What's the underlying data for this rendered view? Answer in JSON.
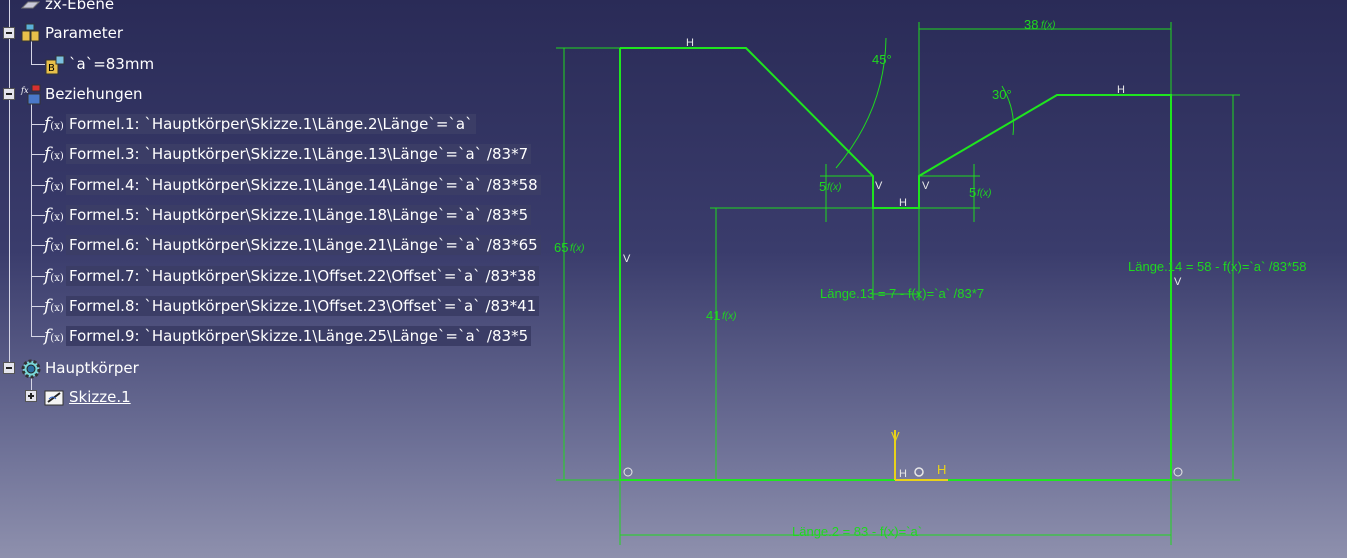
{
  "tree": {
    "top_item": "zx-Ebene",
    "parameter_label": "Parameter",
    "parameter_value": "`a`=83mm",
    "relations_label": "Beziehungen",
    "formulas": [
      "Formel.1: `Hauptkörper\\Skizze.1\\Länge.2\\Länge`=`a`",
      "Formel.3: `Hauptkörper\\Skizze.1\\Länge.13\\Länge`=`a` /83*7",
      "Formel.4: `Hauptkörper\\Skizze.1\\Länge.14\\Länge`=`a` /83*58",
      "Formel.5: `Hauptkörper\\Skizze.1\\Länge.18\\Länge`=`a` /83*5",
      "Formel.6: `Hauptkörper\\Skizze.1\\Länge.21\\Länge`=`a` /83*65",
      "Formel.7: `Hauptkörper\\Skizze.1\\Offset.22\\Offset`=`a` /83*38",
      "Formel.8: `Hauptkörper\\Skizze.1\\Offset.23\\Offset`=`a` /83*41",
      "Formel.9: `Hauptkörper\\Skizze.1\\Länge.25\\Länge`=`a` /83*5"
    ],
    "body_label": "Hauptkörper",
    "sketch_label": "Skizze.1"
  },
  "sketch": {
    "dims": {
      "d38": "38",
      "d45deg": "45°",
      "d30deg": "30°",
      "d5_left": "5",
      "d5_right": "5",
      "d65": "65",
      "d41": "41",
      "len13": "Länge.13 = 7 - f(x)=`a` /83*7",
      "len14": "Länge.14 = 58 - f(x)=`a` /83*58",
      "len2": "Länge.2 = 83 - f(x)=`a`"
    },
    "fx_glyph": "f(x)",
    "constraint_h": "H",
    "constraint_v": "V",
    "colors": {
      "geometry": "#1fe51f",
      "dimension": "#1fd81f",
      "axis": "#e8d21a"
    }
  }
}
